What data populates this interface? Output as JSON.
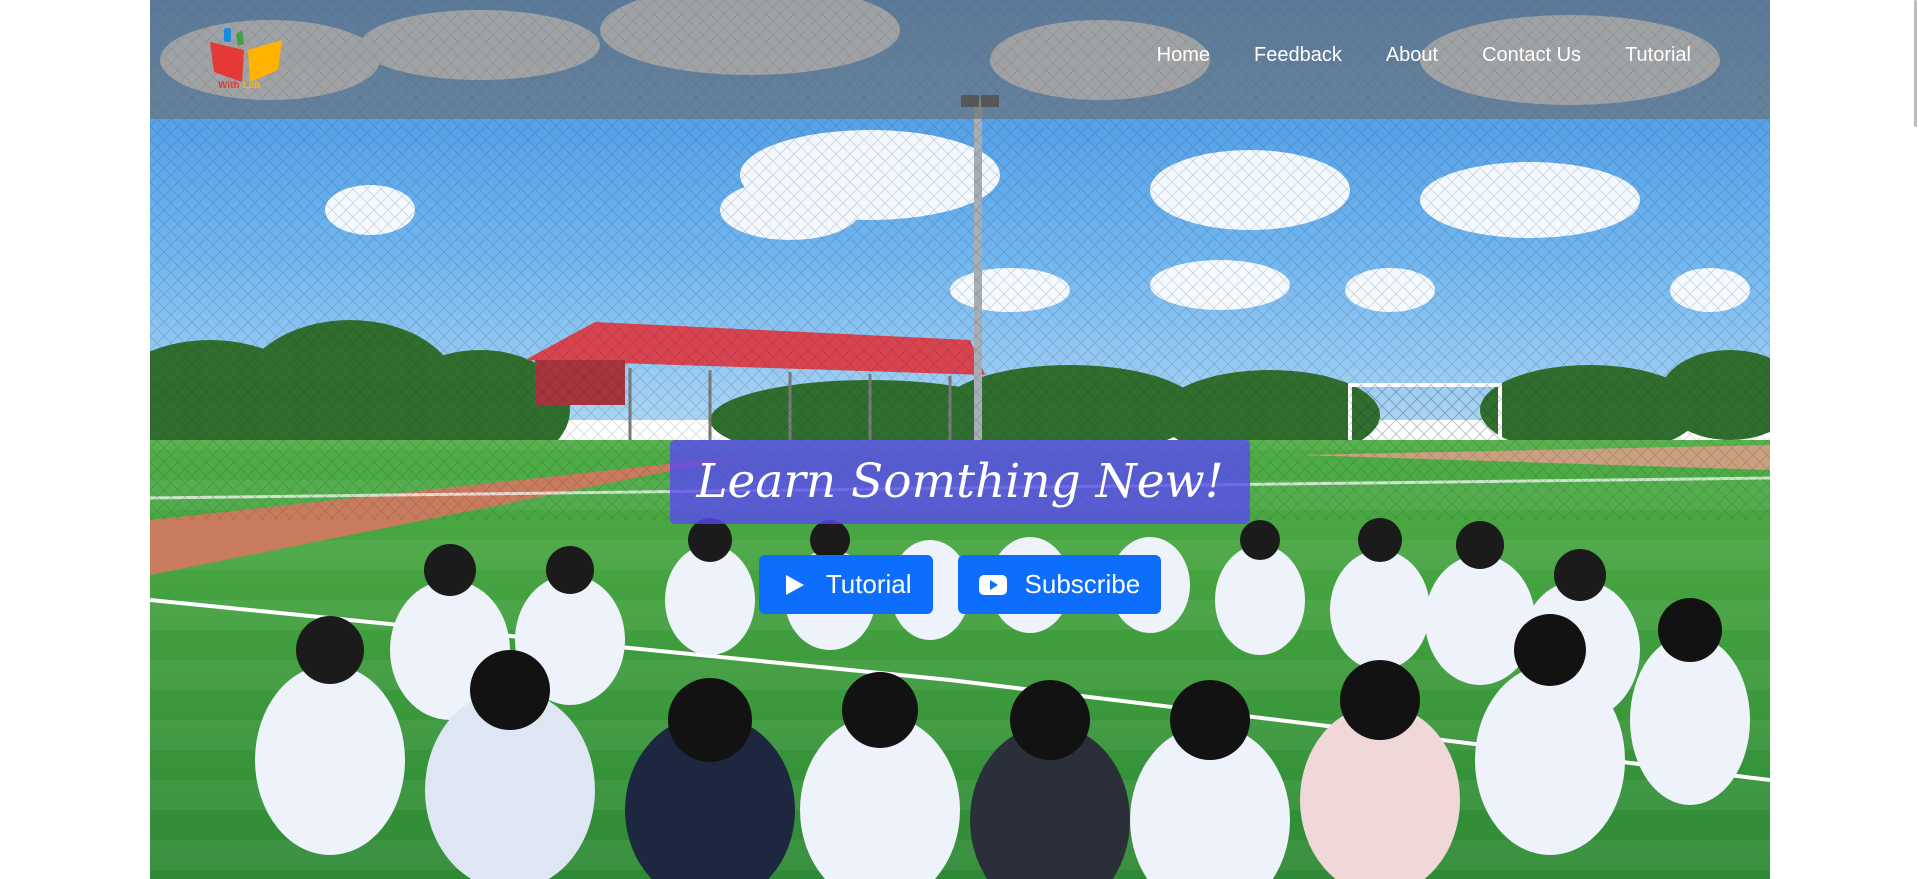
{
  "logo": {
    "icon": "open-book-logo-icon",
    "text_part1": "With",
    "text_part2": "Lab",
    "colors": [
      "#e53935",
      "#ffb300",
      "#1e88e5"
    ]
  },
  "nav": {
    "items": [
      {
        "label": "Home"
      },
      {
        "label": "Feedback"
      },
      {
        "label": "About"
      },
      {
        "label": "Contact Us"
      },
      {
        "label": "Tutorial"
      }
    ]
  },
  "hero": {
    "background_image": "students sitting in a circle on a green football field raising hands under a blue cloudy sky",
    "headline": "Learn Somthing New!",
    "buttons": [
      {
        "label": "Tutorial",
        "icon": "play-icon"
      },
      {
        "label": "Subscribe",
        "icon": "youtube-icon"
      }
    ]
  },
  "colors": {
    "navbar_overlay": "#6e6e6e",
    "headline_bg": "#5a46f5",
    "button_bg": "#0d6efd",
    "text": "#ffffff"
  }
}
